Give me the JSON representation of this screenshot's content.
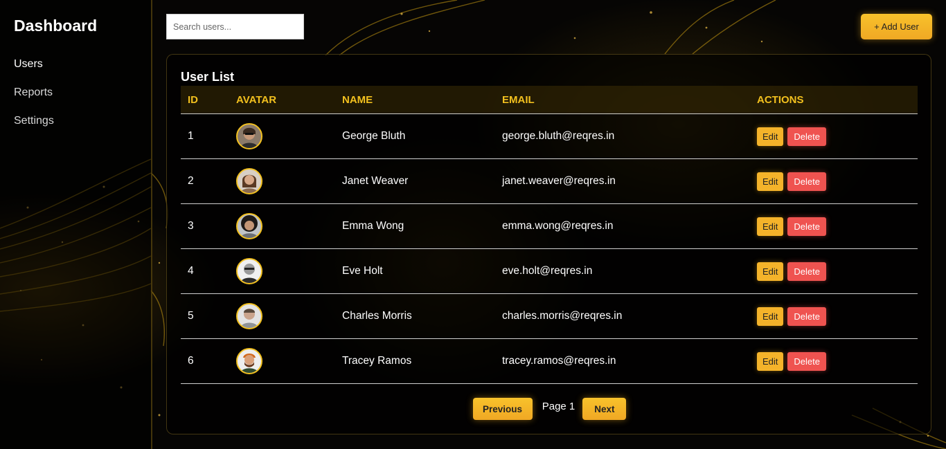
{
  "sidebar": {
    "title": "Dashboard",
    "items": [
      {
        "label": "Users",
        "active": true
      },
      {
        "label": "Reports",
        "active": false
      },
      {
        "label": "Settings",
        "active": false
      }
    ]
  },
  "search": {
    "placeholder": "Search users...",
    "value": ""
  },
  "toolbar": {
    "add_label": "+ Add User"
  },
  "table": {
    "title": "User List",
    "columns": [
      "ID",
      "AVATAR",
      "NAME",
      "EMAIL",
      "ACTIONS"
    ],
    "edit_label": "Edit",
    "delete_label": "Delete",
    "rows": [
      {
        "id": "1",
        "name": "George Bluth",
        "email": "george.bluth@reqres.in"
      },
      {
        "id": "2",
        "name": "Janet Weaver",
        "email": "janet.weaver@reqres.in"
      },
      {
        "id": "3",
        "name": "Emma Wong",
        "email": "emma.wong@reqres.in"
      },
      {
        "id": "4",
        "name": "Eve Holt",
        "email": "eve.holt@reqres.in"
      },
      {
        "id": "5",
        "name": "Charles Morris",
        "email": "charles.morris@reqres.in"
      },
      {
        "id": "6",
        "name": "Tracey Ramos",
        "email": "tracey.ramos@reqres.in"
      }
    ]
  },
  "pagination": {
    "prev_label": "Previous",
    "page_label": "Page 1",
    "next_label": "Next"
  },
  "colors": {
    "accent": "#f2c01e",
    "button": "#f4b32a",
    "danger": "#ef5350",
    "background": "#060504"
  }
}
